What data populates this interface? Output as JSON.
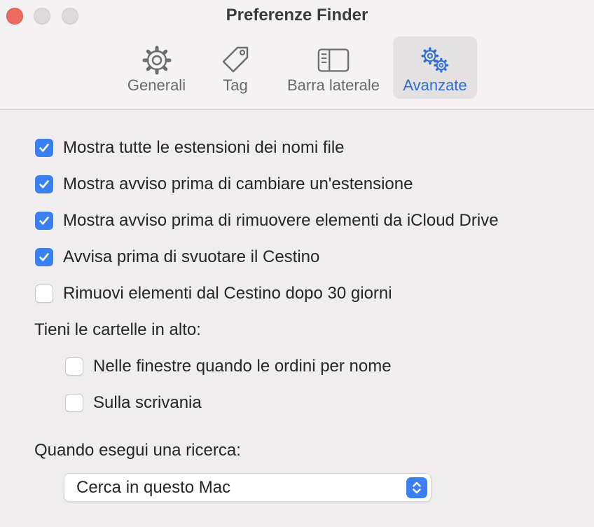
{
  "window": {
    "title": "Preferenze Finder"
  },
  "toolbar": {
    "tabs": [
      {
        "label": "Generali",
        "icon": "gear-icon",
        "active": false
      },
      {
        "label": "Tag",
        "icon": "tag-icon",
        "active": false
      },
      {
        "label": "Barra laterale",
        "icon": "sidebar-icon",
        "active": false
      },
      {
        "label": "Avanzate",
        "icon": "gears-icon",
        "active": true
      }
    ]
  },
  "options": [
    {
      "label": "Mostra tutte le estensioni dei nomi file",
      "checked": true
    },
    {
      "label": "Mostra avviso prima di cambiare un'estensione",
      "checked": true
    },
    {
      "label": "Mostra avviso prima di rimuovere elementi da iCloud Drive",
      "checked": true
    },
    {
      "label": "Avvisa prima di svuotare il Cestino",
      "checked": true
    },
    {
      "label": "Rimuovi elementi dal Cestino dopo 30 giorni",
      "checked": false
    }
  ],
  "folders_on_top": {
    "heading": "Tieni le cartelle in alto:",
    "options": [
      {
        "label": "Nelle finestre quando le ordini per nome",
        "checked": false
      },
      {
        "label": "Sulla scrivania",
        "checked": false
      }
    ]
  },
  "search": {
    "heading": "Quando esegui una ricerca:",
    "selected": "Cerca in questo Mac"
  },
  "colors": {
    "accent": "#3a80f3",
    "active_tab_text": "#2f6fd2",
    "close_button": "#ed6a5e"
  }
}
